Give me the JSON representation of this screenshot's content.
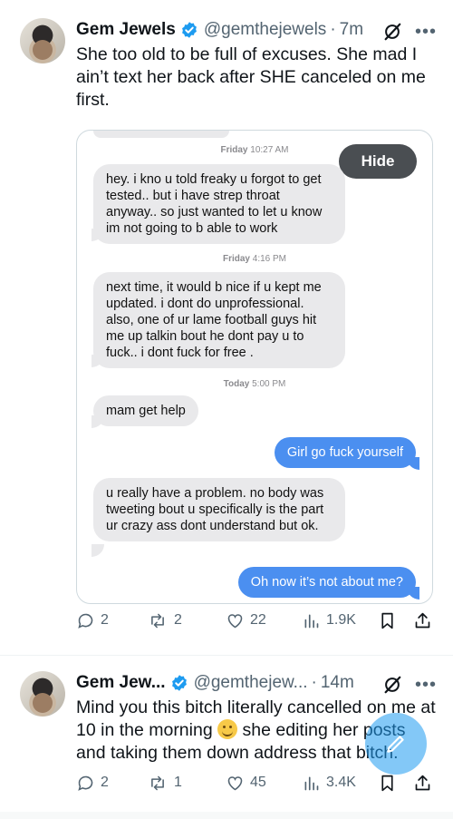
{
  "tweet1": {
    "name": "Gem Jewels",
    "handle": "@gemthejewels",
    "separator": "·",
    "time": "7m",
    "more": "•••",
    "text": "She too old to be full of excuses. She mad I ain’t text her back after SHE canceled on me first.",
    "screenshot": {
      "hide_label": "Hide",
      "messages": [
        {
          "type": "stamp",
          "day": "Friday",
          "time": "10:27 AM"
        },
        {
          "type": "in",
          "text": "hey. i kno u told freaky u forgot to get tested.. but i have strep throat anyway.. so just wanted to let u know im not going to b able to work"
        },
        {
          "type": "stamp",
          "day": "Friday",
          "time": "4:16 PM"
        },
        {
          "type": "in",
          "text": "next time, it would b nice if u kept me updated. i dont do unprofessional. also, one of ur lame football guys hit me up talkin bout he dont pay u to fuck.. i dont fuck for free ."
        },
        {
          "type": "stamp",
          "day": "Today",
          "time": "5:00 PM"
        },
        {
          "type": "in",
          "text": "mam get help"
        },
        {
          "type": "out",
          "text": "Girl go fuck yourself"
        },
        {
          "type": "in",
          "text": "u really have a problem. no body was tweeting bout u specifically is the part ur crazy ass dont understand but ok."
        },
        {
          "type": "out",
          "text": "Oh now it’s not about me?"
        }
      ]
    },
    "actions": {
      "replies": "2",
      "reposts": "2",
      "likes": "22",
      "views": "1.9K"
    }
  },
  "tweet2": {
    "name": "Gem Jew...",
    "handle": "@gemthejew...",
    "separator": "·",
    "time": "14m",
    "more": "•••",
    "text_part1": "Mind you this bitch literally cancelled on me at 10 in the morning ",
    "emoji": "smiling-face-emoji",
    "text_part2": " she editing her posts and taking them down address that bitch.",
    "actions": {
      "replies": "2",
      "reposts": "1",
      "likes": "45",
      "views": "3.4K"
    }
  },
  "colors": {
    "imessage_blue": "#4b8ff0",
    "imessage_gray": "#e9e9eb",
    "verified_blue": "#1d9bf0",
    "secondary_text": "#536471"
  },
  "icons": [
    "verified-badge-icon",
    "grok-icon",
    "more-icon",
    "reply-icon",
    "repost-icon",
    "like-icon",
    "views-icon",
    "bookmark-icon",
    "share-icon",
    "compose-icon"
  ]
}
